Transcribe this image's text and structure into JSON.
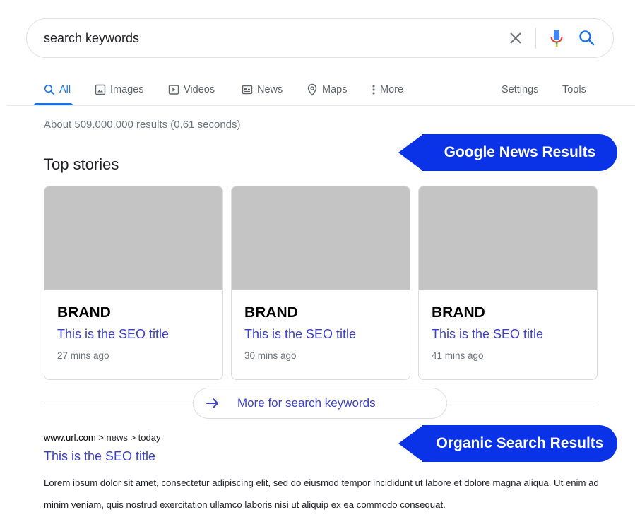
{
  "search": {
    "query": "search keywords"
  },
  "tabs": [
    {
      "label": "All",
      "icon": "search-icon",
      "active": true
    },
    {
      "label": "Images",
      "icon": "image-icon"
    },
    {
      "label": "Videos",
      "icon": "video-icon"
    },
    {
      "label": "News",
      "icon": "news-icon"
    },
    {
      "label": "Maps",
      "icon": "map-pin-icon"
    },
    {
      "label": "More",
      "icon": "more-vertical-icon"
    }
  ],
  "tools": {
    "settings": "Settings",
    "tools": "Tools"
  },
  "result_stats": "About 509.000.000 results (0,61 seconds)",
  "callouts": {
    "news": "Google News Results",
    "organic": "Organic Search Results"
  },
  "top_stories": {
    "heading": "Top stories",
    "cards": [
      {
        "brand": "BRAND",
        "title": "This is the SEO title",
        "time": "27 mins ago"
      },
      {
        "brand": "BRAND",
        "title": "This is the SEO title",
        "time": "30 mins ago"
      },
      {
        "brand": "BRAND",
        "title": "This is the SEO title",
        "time": "41 mins ago"
      }
    ],
    "more_label": "More for search keywords"
  },
  "organic": {
    "url_domain": "www.url.com",
    "url_path": " > news > today",
    "title": "This is the SEO title",
    "snippet": "Lorem ipsum dolor sit amet, consectetur adipiscing elit, sed do eiusmod tempor incididunt ut labore et dolore magna aliqua. Ut enim ad minim veniam, quis nostrud exercitation ullamco laboris nisi ut aliquip ex ea commodo consequat."
  },
  "colors": {
    "link": "#3c40c6",
    "accent": "#1a73e8",
    "callout": "#0a33e8"
  }
}
